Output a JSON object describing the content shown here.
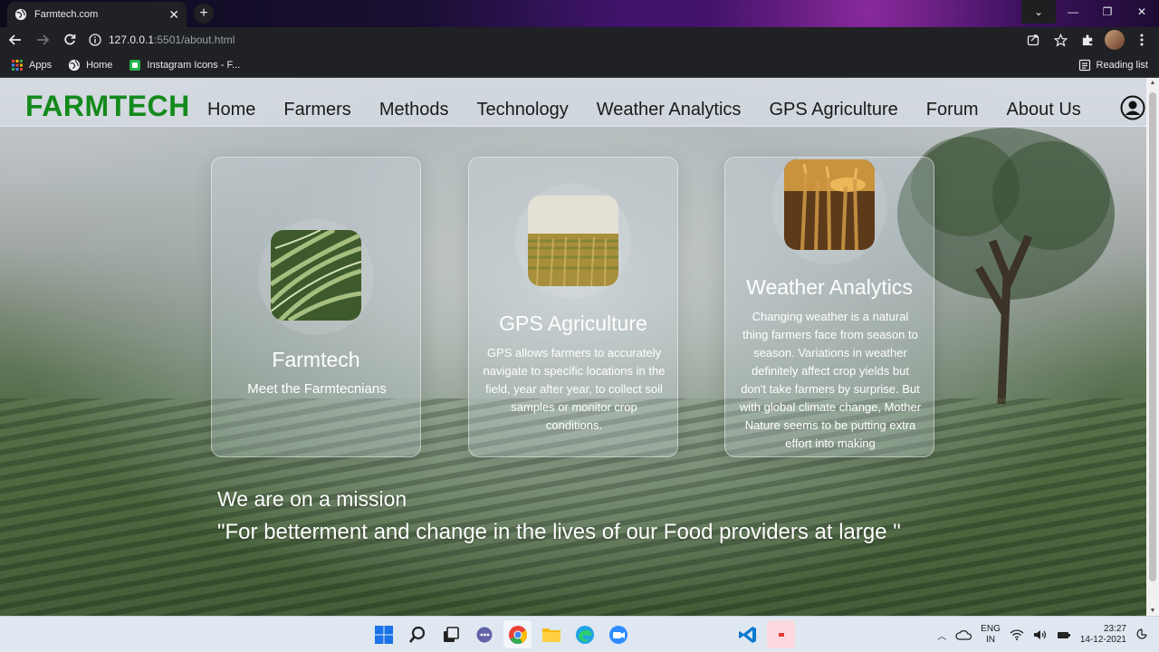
{
  "browser": {
    "tab_title": "Farmtech.com",
    "url_host": "127.0.0.1",
    "url_path": ":5501/about.html",
    "bookmarks": [
      {
        "label": "Apps",
        "icon": "apps-grid-icon"
      },
      {
        "label": "Home",
        "icon": "globe-icon"
      },
      {
        "label": "Instagram Icons - F...",
        "icon": "bookmark-green-icon"
      }
    ],
    "reading_list": "Reading list"
  },
  "site": {
    "brand": "FARMTECH",
    "brand_color": "#138a1b",
    "nav": [
      "Home",
      "Farmers",
      "Methods",
      "Technology",
      "Weather Analytics",
      "GPS Agriculture",
      "Forum",
      "About Us"
    ],
    "cards": [
      {
        "title": "Farmtech",
        "text": "Meet the Farmtecnians",
        "image": "windblown-grass"
      },
      {
        "title": "GPS Agriculture",
        "text": "GPS allows farmers to accurately navigate to specific locations in the field, year after year, to collect soil samples or monitor crop conditions.",
        "image": "wheat-field"
      },
      {
        "title": "Weather Analytics",
        "text": "Changing weather is a natural thing farmers face from season to season. Variations in weather definitely affect crop yields but don't take farmers by surprise. But with global climate change, Mother Nature seems to be putting extra effort into making",
        "image": "wheat-sunset"
      }
    ],
    "mission": "We are on a mission",
    "quote": "\"For betterment and change in the lives of our Food providers at large \""
  },
  "taskbar": {
    "apps": [
      "windows-start-icon",
      "search-icon",
      "task-view-icon",
      "chat-icon",
      "chrome-icon",
      "file-explorer-icon",
      "edge-icon",
      "zoom-icon",
      "vscode-icon",
      "app-icon"
    ],
    "lang_top": "ENG",
    "lang_bottom": "IN",
    "time": "23:27",
    "date": "14-12-2021"
  }
}
